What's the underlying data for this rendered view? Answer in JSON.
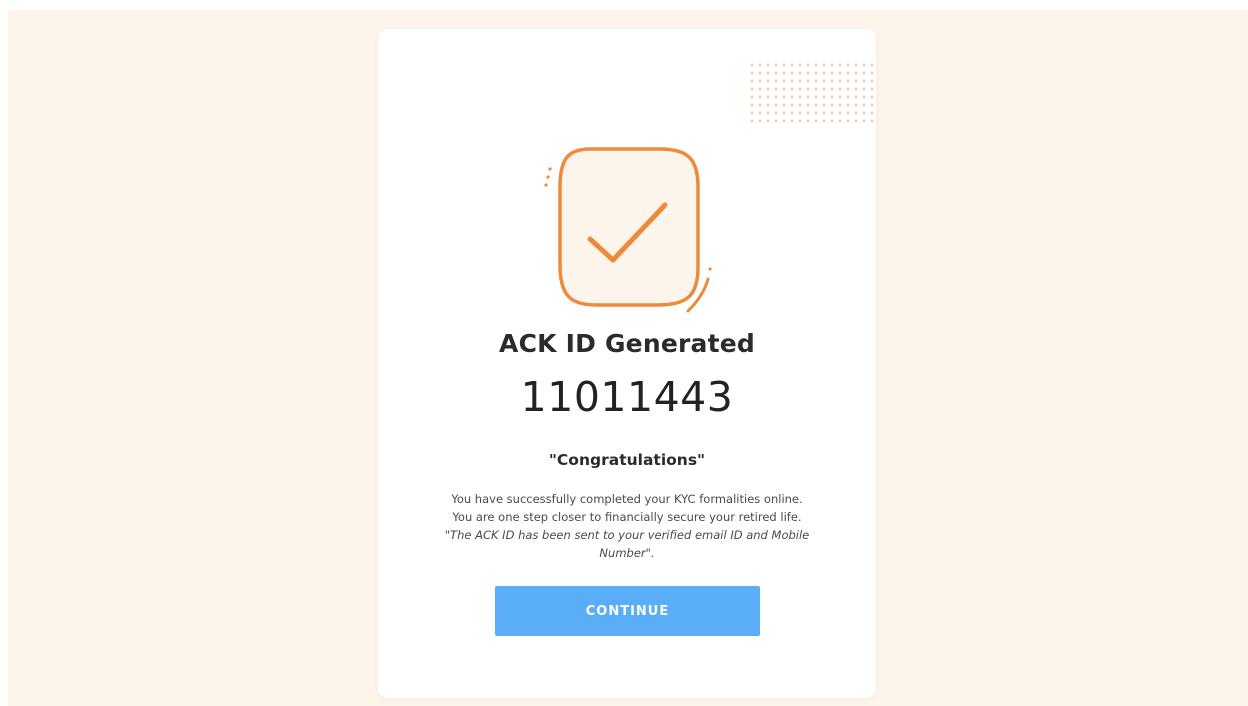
{
  "ack": {
    "title": "ACK ID Generated",
    "id_number": "11011443"
  },
  "message": {
    "heading": "\"Congratulations\"",
    "line1": "You have successfully completed your KYC formalities online.",
    "line2": "You are one step closer to financially secure your retired life.",
    "note": "\"The ACK ID has been sent to your verified email ID and Mobile Number\"."
  },
  "actions": {
    "continue_label": "CONTINUE"
  },
  "icons": {
    "success": "check-badge-icon",
    "decoration": "dot-grid"
  },
  "colors": {
    "accent_orange": "#ee8a3c",
    "button_blue": "#5aaef7",
    "page_background": "#fdf4eb"
  }
}
